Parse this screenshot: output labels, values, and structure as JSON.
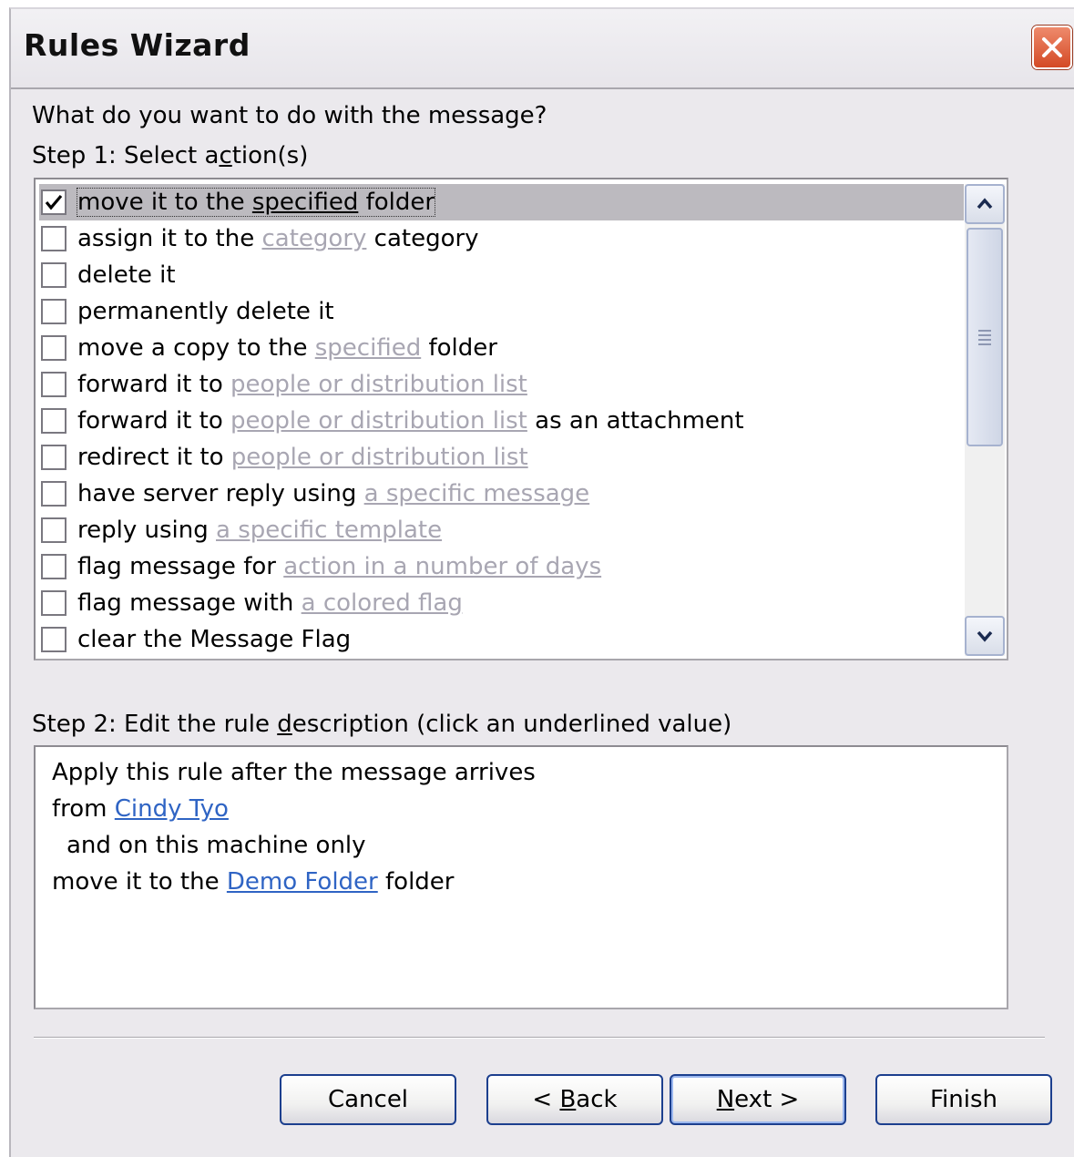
{
  "window": {
    "title": "Rules Wizard"
  },
  "prompt": "What do you want to do with the message?",
  "step1": {
    "label_before": "Step 1: Select a",
    "label_mnemonic": "c",
    "label_after": "tion(s)"
  },
  "actions": [
    {
      "checked": true,
      "parts": [
        {
          "t": "move it to the ",
          "s": "plain"
        },
        {
          "t": "specified",
          "s": "hl"
        },
        {
          "t": " folder",
          "s": "plain"
        }
      ]
    },
    {
      "checked": false,
      "parts": [
        {
          "t": "assign it to the ",
          "s": "plain"
        },
        {
          "t": "category",
          "s": "ph"
        },
        {
          "t": " category",
          "s": "plain"
        }
      ]
    },
    {
      "checked": false,
      "parts": [
        {
          "t": "delete it",
          "s": "plain"
        }
      ]
    },
    {
      "checked": false,
      "parts": [
        {
          "t": "permanently delete it",
          "s": "plain"
        }
      ]
    },
    {
      "checked": false,
      "parts": [
        {
          "t": "move a copy to the ",
          "s": "plain"
        },
        {
          "t": "specified",
          "s": "ph"
        },
        {
          "t": " folder",
          "s": "plain"
        }
      ]
    },
    {
      "checked": false,
      "parts": [
        {
          "t": "forward it to ",
          "s": "plain"
        },
        {
          "t": "people or distribution list",
          "s": "ph"
        }
      ]
    },
    {
      "checked": false,
      "parts": [
        {
          "t": "forward it to ",
          "s": "plain"
        },
        {
          "t": "people or distribution list",
          "s": "ph"
        },
        {
          "t": " as an attachment",
          "s": "plain"
        }
      ]
    },
    {
      "checked": false,
      "parts": [
        {
          "t": "redirect it to ",
          "s": "plain"
        },
        {
          "t": "people or distribution list",
          "s": "ph"
        }
      ]
    },
    {
      "checked": false,
      "parts": [
        {
          "t": "have server reply using ",
          "s": "plain"
        },
        {
          "t": "a specific message",
          "s": "ph"
        }
      ]
    },
    {
      "checked": false,
      "parts": [
        {
          "t": "reply using ",
          "s": "plain"
        },
        {
          "t": "a specific template",
          "s": "ph"
        }
      ]
    },
    {
      "checked": false,
      "parts": [
        {
          "t": "flag message for ",
          "s": "plain"
        },
        {
          "t": "action in a number of days",
          "s": "ph"
        }
      ]
    },
    {
      "checked": false,
      "parts": [
        {
          "t": "flag message with ",
          "s": "plain"
        },
        {
          "t": "a colored flag",
          "s": "ph"
        }
      ]
    },
    {
      "checked": false,
      "parts": [
        {
          "t": "clear the Message Flag",
          "s": "plain"
        }
      ]
    }
  ],
  "step2": {
    "label_before": "Step 2: Edit the rule ",
    "label_mnemonic": "d",
    "label_after": "escription (click an underlined value)"
  },
  "description": {
    "line1": "Apply this rule after the message arrives",
    "line2_prefix": "from ",
    "line2_link": "Cindy Tyo",
    "line3": "and on this machine only",
    "line4_prefix": "move it to the ",
    "line4_link": "Demo Folder",
    "line4_suffix": " folder"
  },
  "buttons": {
    "cancel": "Cancel",
    "back_prefix": "< ",
    "back_mnemonic": "B",
    "back_rest": "ack",
    "next_mnemonic": "N",
    "next_rest": "ext >",
    "finish": "Finish"
  },
  "colors": {
    "placeholder_link": "#a8a6b2",
    "value_link": "#2f64c4",
    "selected_row": "#bcbabf"
  }
}
